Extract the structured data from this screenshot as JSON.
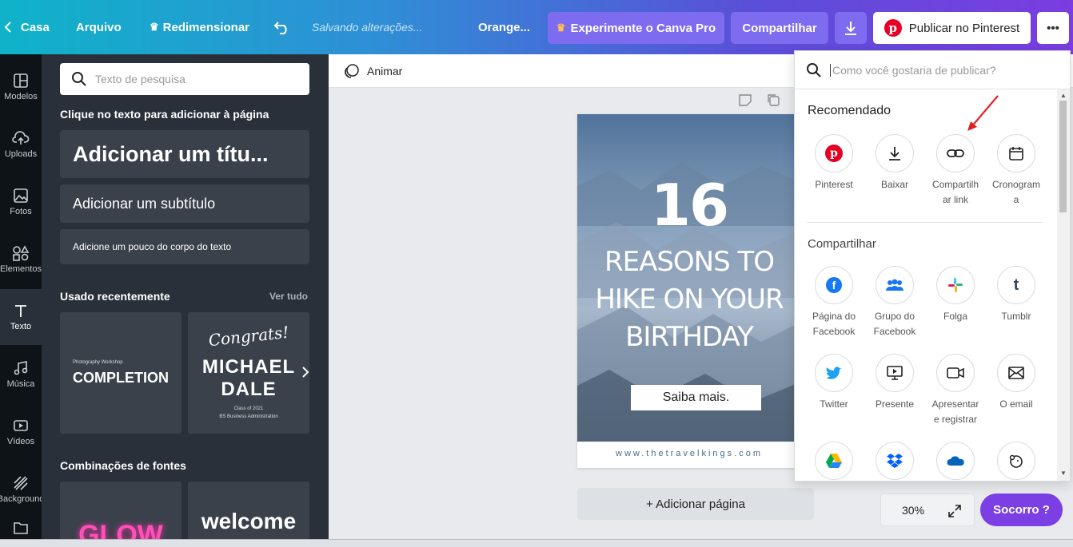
{
  "topbar": {
    "home": "Casa",
    "file": "Arquivo",
    "resize": "Redimensionar",
    "saving": "Salvando alterações...",
    "doc_name": "Orange...",
    "try_pro": "Experimente o Canva Pro",
    "share": "Compartilhar",
    "publish": "Publicar no Pinterest",
    "more": "•••",
    "gradient": [
      "#0fb3c9",
      "#7b3ce0"
    ],
    "pro_color": "#8a79f0",
    "pinterest_color": "#e60023"
  },
  "rail": [
    {
      "label": "Modelos",
      "icon": "layout-icon"
    },
    {
      "label": "Uploads",
      "icon": "cloud-upload-icon"
    },
    {
      "label": "Fotos",
      "icon": "image-icon"
    },
    {
      "label": "Elementos",
      "icon": "shapes-icon"
    },
    {
      "label": "Texto",
      "icon": "text-icon",
      "active": true
    },
    {
      "label": "Música",
      "icon": "music-icon"
    },
    {
      "label": "Vídeos",
      "icon": "video-icon"
    },
    {
      "label": "Background",
      "icon": "background-icon"
    },
    {
      "label": "",
      "icon": "folder-icon"
    }
  ],
  "panel": {
    "search_placeholder": "Texto de pesquisa",
    "click_hint": "Clique no texto para adicionar à página",
    "add_title": "Adicionar um títu...",
    "add_subtitle": "Adicionar um subtítulo",
    "add_body": "Adicione um pouco do corpo do texto",
    "recent": "Usado recentemente",
    "see_all": "Ver tudo",
    "recent1": {
      "small": "Photography Workshop",
      "big": "COMPLETION"
    },
    "recent2": {
      "script": "Congrats!",
      "name1": "MICHAEL",
      "name2": "DALE",
      "line1": "Class of 2021",
      "line2": "BS Business Administration"
    },
    "combos": "Combinações de fontes",
    "combo1": "GLOW",
    "combo2": "welcome"
  },
  "canvas": {
    "animate": "Animar",
    "number": "16",
    "line1": "REASONS TO",
    "line2": "HIKE ON YOUR",
    "line3": "BIRTHDAY",
    "button": "Saiba mais.",
    "url": "www.thetravelkings.com",
    "add_page": "+ Adicionar página",
    "zoom": "30%",
    "help": "Socorro ?"
  },
  "popup": {
    "search_placeholder": "Como você gostaria de publicar?",
    "recommended": "Recomendado",
    "rec": [
      {
        "l1": "Pinterest",
        "l2": "",
        "icon": "pinterest-icon"
      },
      {
        "l1": "Baixar",
        "l2": "",
        "icon": "download-icon"
      },
      {
        "l1": "Compartilh",
        "l2": "ar link",
        "icon": "link-icon"
      },
      {
        "l1": "Cronogram",
        "l2": "a",
        "icon": "calendar-icon"
      }
    ],
    "share": "Compartilhar",
    "row1": [
      {
        "l1": "Página do",
        "l2": "Facebook",
        "icon": "facebook-icon"
      },
      {
        "l1": "Grupo do",
        "l2": "Facebook",
        "icon": "facebook-group-icon"
      },
      {
        "l1": "Folga",
        "l2": "",
        "icon": "slack-icon"
      },
      {
        "l1": "Tumblr",
        "l2": "",
        "icon": "tumblr-icon"
      }
    ],
    "row2": [
      {
        "l1": "Twitter",
        "l2": "",
        "icon": "twitter-icon"
      },
      {
        "l1": "Presente",
        "l2": "",
        "icon": "present-icon"
      },
      {
        "l1": "Apresentar",
        "l2": "e registrar",
        "icon": "record-icon"
      },
      {
        "l1": "O email",
        "l2": "",
        "icon": "email-icon"
      }
    ],
    "row3": [
      {
        "icon": "google-drive-icon"
      },
      {
        "icon": "dropbox-icon"
      },
      {
        "icon": "onedrive-icon"
      },
      {
        "icon": "mailchimp-icon"
      }
    ]
  }
}
